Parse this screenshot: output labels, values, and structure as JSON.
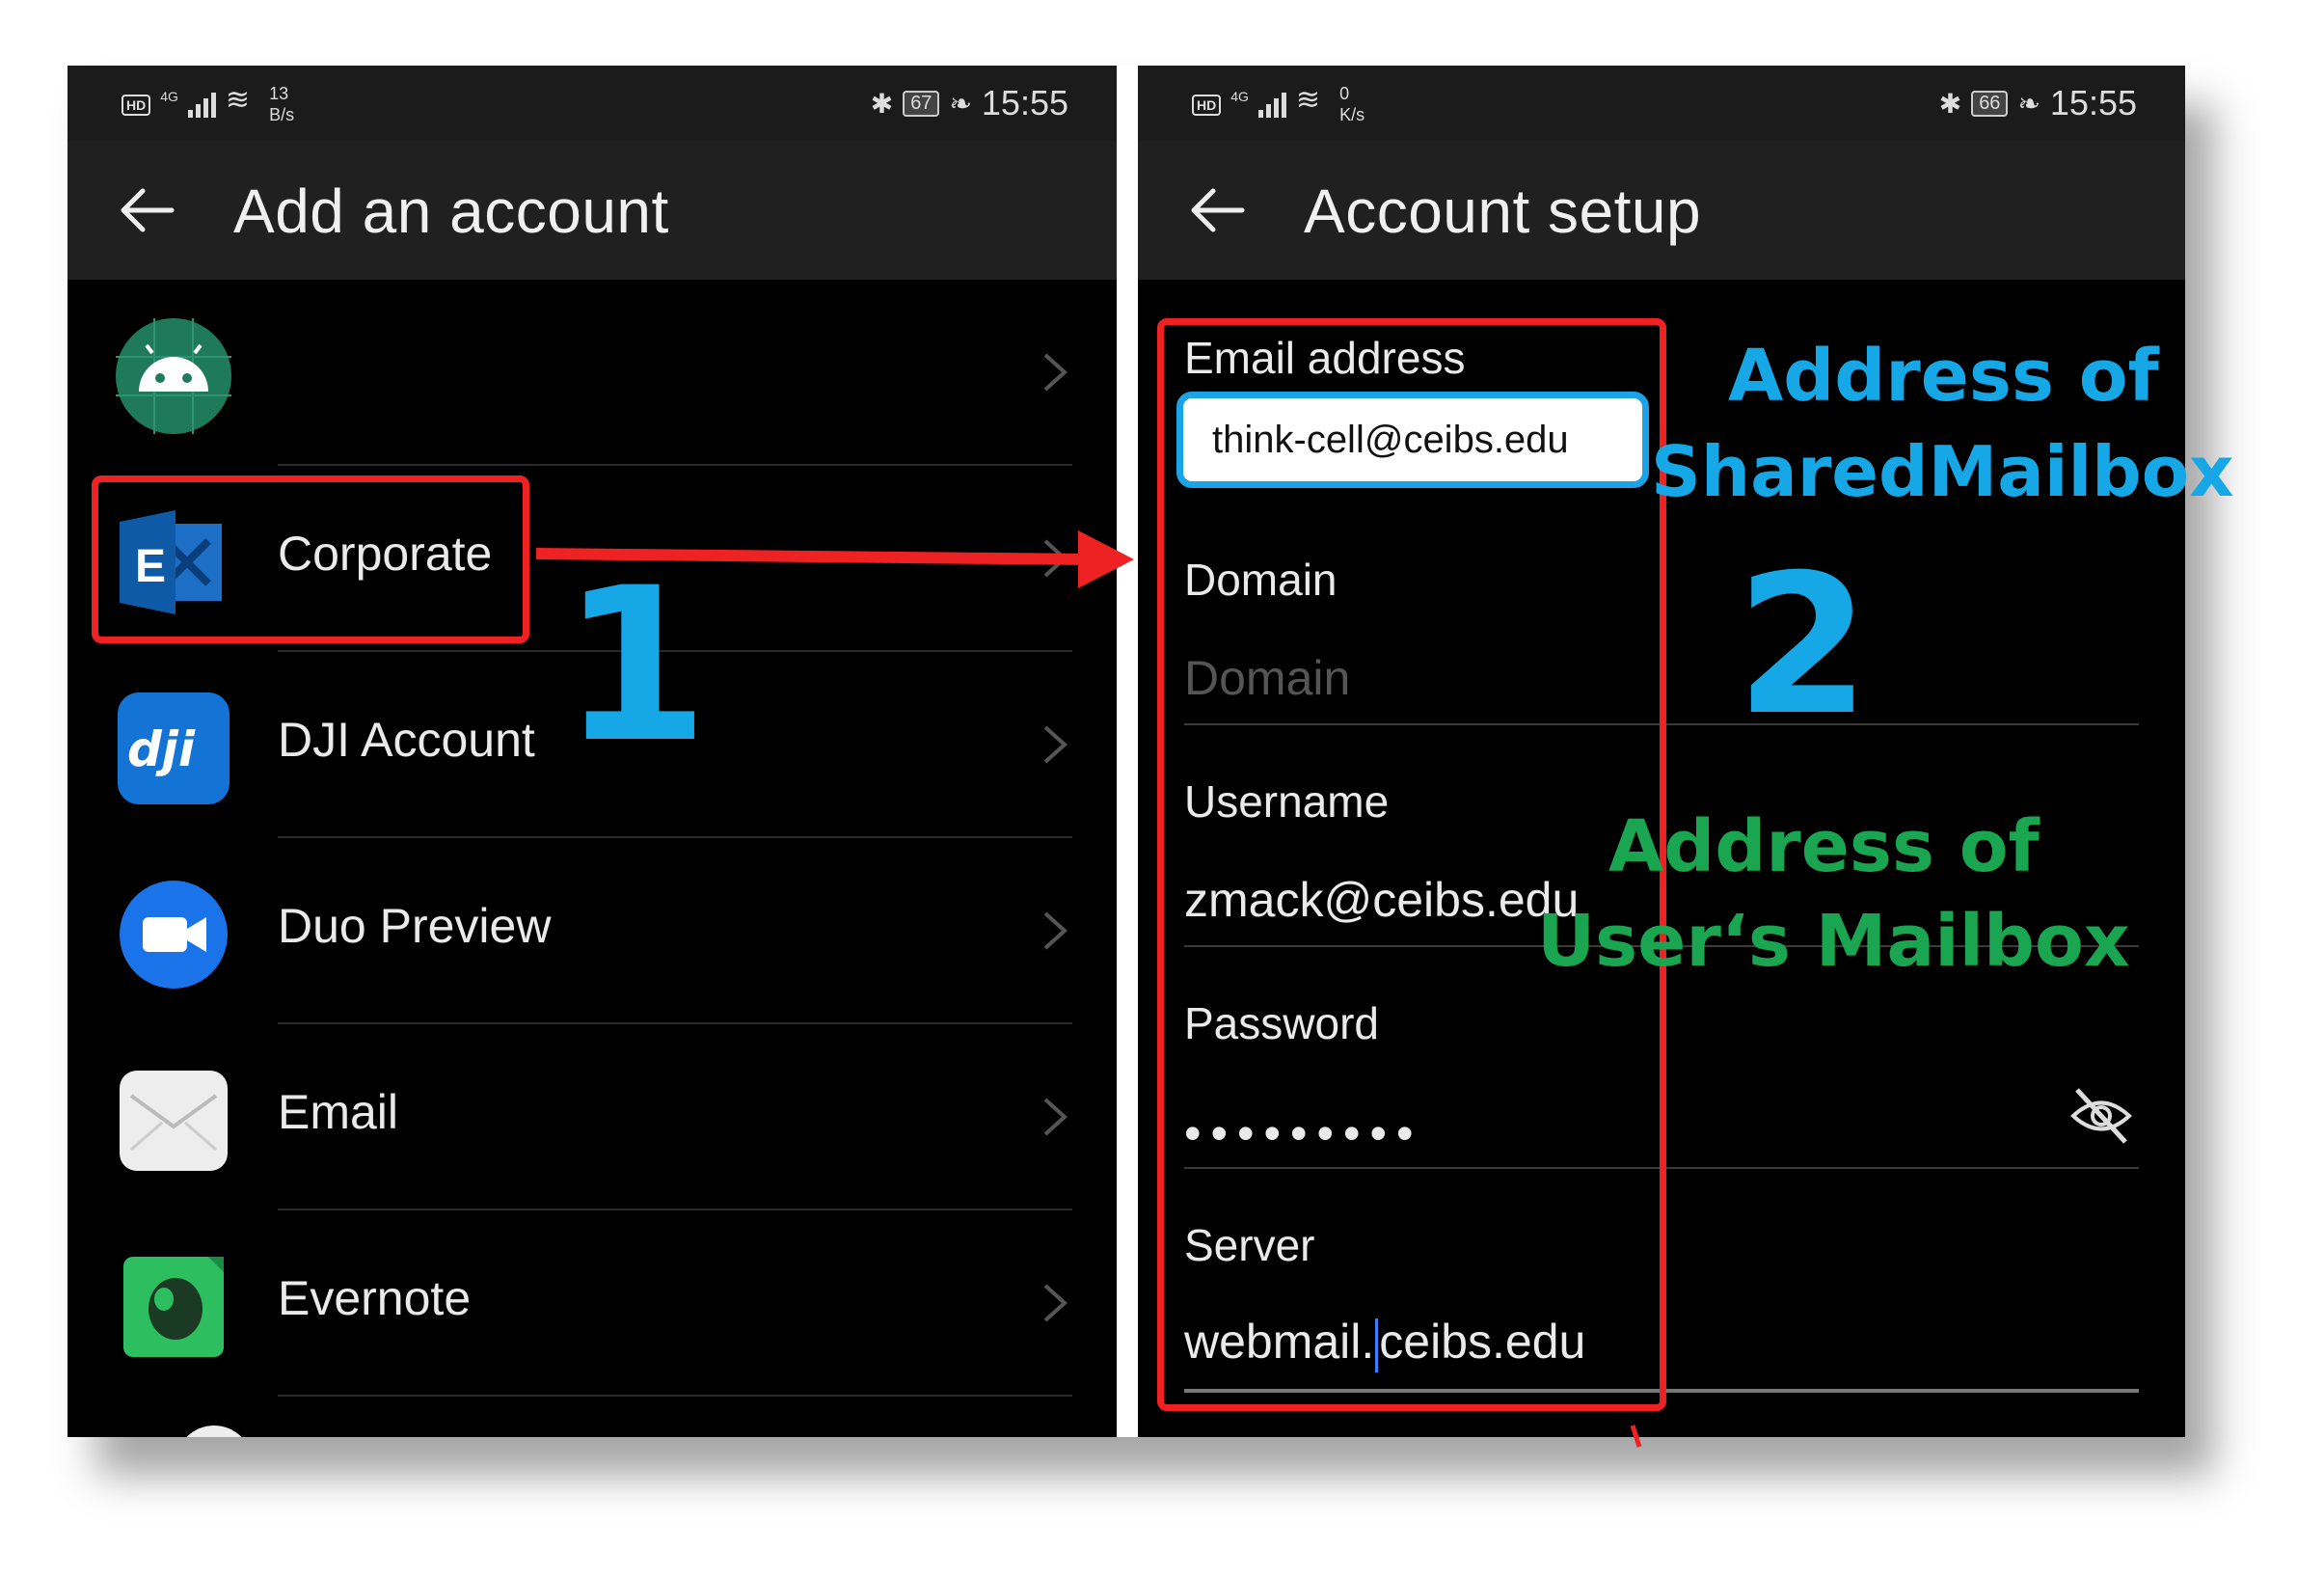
{
  "colors": {
    "annotation_blue": "#16a8e6",
    "annotation_green": "#1aa651",
    "annotation_red": "#ee2222",
    "screen_bg": "#000000"
  },
  "left_screen": {
    "status": {
      "hd": "HD",
      "signal": "4G",
      "rate_value": "13",
      "rate_unit": "B/s",
      "battery": "67",
      "time": "15:55"
    },
    "title": "Add an account",
    "back_icon": "arrow-left-icon",
    "items": [
      {
        "label": "",
        "icon": "android-icon"
      },
      {
        "label": "Corporate",
        "icon": "exchange-icon"
      },
      {
        "label": "DJI Account",
        "icon": "dji-icon"
      },
      {
        "label": "Duo Preview",
        "icon": "duo-video-icon"
      },
      {
        "label": "Email",
        "icon": "envelope-icon"
      },
      {
        "label": "Evernote",
        "icon": "evernote-elephant-icon"
      }
    ]
  },
  "right_screen": {
    "status": {
      "hd": "HD",
      "signal": "4G",
      "rate_value": "0",
      "rate_unit": "K/s",
      "battery": "66",
      "time": "15:55"
    },
    "title": "Account setup",
    "fields": {
      "email_label": "Email address",
      "email_value": "think-cell@ceibs.edu",
      "domain_label": "Domain",
      "domain_placeholder": "Domain",
      "username_label": "Username",
      "username_value": "zmack@ceibs.edu",
      "password_label": "Password",
      "password_value": "•••••••••",
      "server_label": "Server",
      "server_value_before_cursor": "webmail.",
      "server_value_after_cursor": "ceibs.edu"
    }
  },
  "annotations": {
    "step1": "1",
    "step2": "2",
    "shared_line1": "Address of",
    "shared_line2": "SharedMailbox",
    "user_line1": "Address of",
    "user_line2": "User‘s Mailbox"
  }
}
